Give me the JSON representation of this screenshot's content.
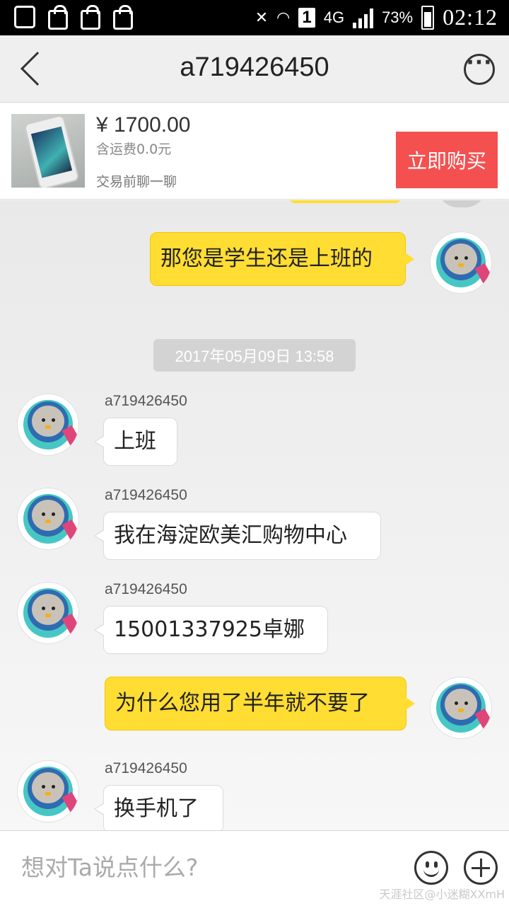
{
  "status_bar": {
    "network": "4G",
    "sim": "1",
    "battery": "73%",
    "time": "02:12"
  },
  "header": {
    "title": "a719426450"
  },
  "product": {
    "price": "¥ 1700.00",
    "shipping": "含运费0.0元",
    "hint": "交易前聊一聊",
    "buy_label": "立即购买"
  },
  "chat": {
    "timestamp": "2017年05月09日 13:58",
    "messages": [
      {
        "from": "me",
        "text": "那您是学生还是上班的"
      },
      {
        "from": "them",
        "sender": "a719426450",
        "text": "上班"
      },
      {
        "from": "them",
        "sender": "a719426450",
        "text": "我在海淀欧美汇购物中心"
      },
      {
        "from": "them",
        "sender": "a719426450",
        "text": "15001337925卓娜"
      },
      {
        "from": "me",
        "text": "为什么您用了半年就不要了"
      },
      {
        "from": "them",
        "sender": "a719426450",
        "text": "换手机了"
      }
    ]
  },
  "input": {
    "placeholder": "想对Ta说点什么?"
  },
  "watermark": "天涯社区@小迷糊XXmH"
}
